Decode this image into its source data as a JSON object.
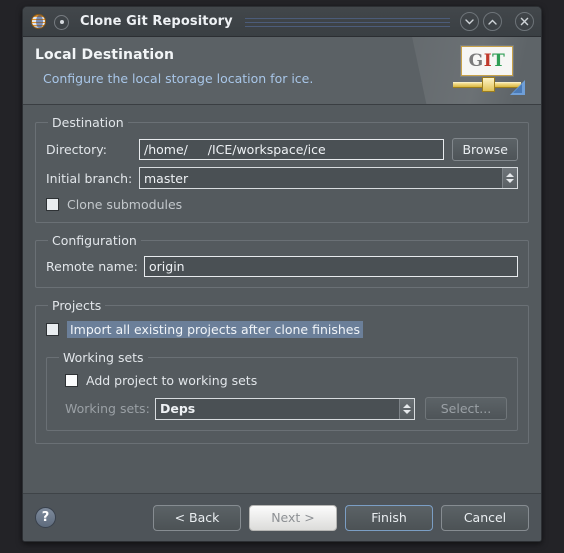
{
  "window": {
    "title": "Clone Git Repository",
    "icons": {
      "app": "globe-icon",
      "secondary": "dot-icon",
      "minimize": "chevron-down-icon",
      "maximize": "chevron-up-icon",
      "close": "close-icon"
    }
  },
  "banner": {
    "title": "Local Destination",
    "subtitle": "Configure the local storage location for ice.",
    "logo": {
      "letters": [
        "G",
        "I",
        "T"
      ],
      "name": "git-logo"
    },
    "colors": {
      "letter_g": "#7b7b7b",
      "letter_i": "#c0392b",
      "letter_t": "#2e9e55"
    }
  },
  "destination": {
    "legend": "Destination",
    "directory_label": "Directory:",
    "directory_value": "/home/     /ICE/workspace/ice",
    "browse_label": "Browse",
    "branch_label": "Initial branch:",
    "branch_value": "master",
    "clone_submodules_label": "Clone submodules",
    "clone_submodules_checked": false
  },
  "configuration": {
    "legend": "Configuration",
    "remote_label": "Remote name:",
    "remote_value": "origin"
  },
  "projects": {
    "legend": "Projects",
    "import_label": "Import all existing projects after clone finishes",
    "import_checked": false,
    "working_sets": {
      "legend": "Working sets",
      "add_label": "Add project to working sets",
      "add_checked": false,
      "sets_label": "Working sets:",
      "sets_value": "Deps",
      "select_label": "Select..."
    }
  },
  "footer": {
    "help_glyph": "?",
    "back_label": "< Back",
    "next_label": "Next >",
    "finish_label": "Finish",
    "cancel_label": "Cancel"
  },
  "colors": {
    "panel": "#545a5e",
    "banner": "#5b6165",
    "titlebar": "#3f4448",
    "accent_link": "#a8c6e8",
    "selection": "#6b7f99",
    "focus_border": "#7b9ec4"
  }
}
